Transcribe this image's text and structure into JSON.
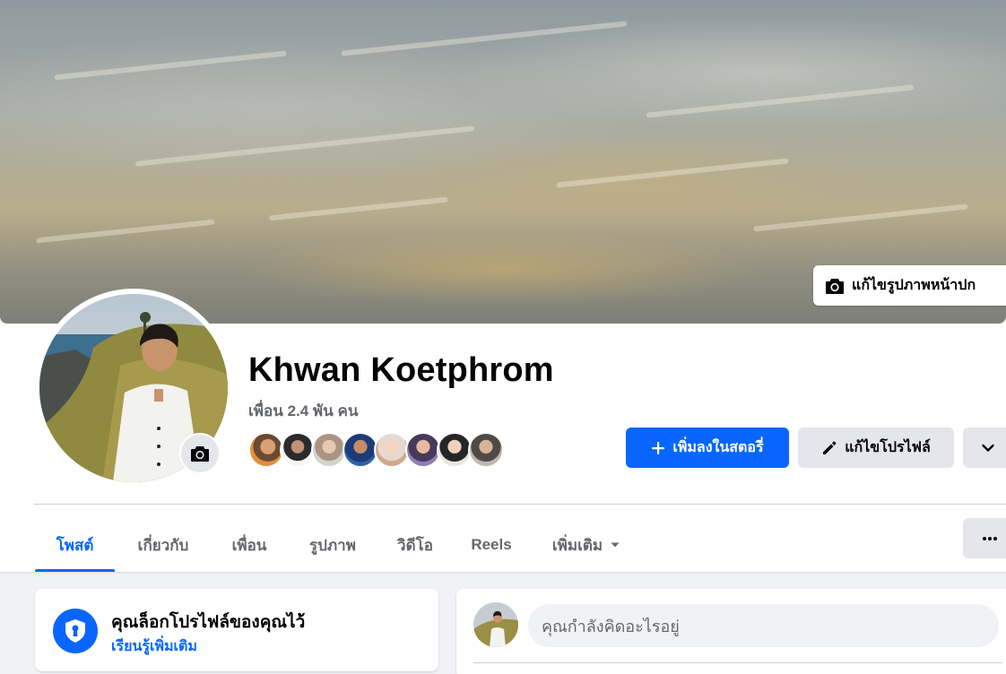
{
  "cover": {
    "edit_button_label": "แก้ไขรูปภาพหน้าปก",
    "edit_button_icon": "camera-icon"
  },
  "profile": {
    "name": "Khwan Koetphrom",
    "friend_count_text": "เพื่อน 2.4 พัน คน",
    "avatar_camera_icon": "camera-icon",
    "friend_avatar_count": 8
  },
  "actions": {
    "add_story_label": "เพิ่มลงในสตอรี่",
    "add_story_icon": "plus-icon",
    "edit_profile_label": "แก้ไขโปรไฟล์",
    "edit_profile_icon": "pencil-icon",
    "more_icon": "chevron-down-icon"
  },
  "tabs": {
    "items": [
      {
        "label": "โพสต์",
        "active": true
      },
      {
        "label": "เกี่ยวกับ",
        "active": false
      },
      {
        "label": "เพื่อน",
        "active": false
      },
      {
        "label": "รูปภาพ",
        "active": false
      },
      {
        "label": "วิดีโอ",
        "active": false
      },
      {
        "label": "Reels",
        "active": false
      },
      {
        "label": "เพิ่มเติม",
        "active": false
      }
    ],
    "more_dropdown_icon": "caret-down-icon",
    "overflow_icon": "ellipsis-icon"
  },
  "lock_notice": {
    "title": "คุณล็อกโปรไฟล์ของคุณไว้",
    "link": "เรียนรู้เพิ่มเติม",
    "icon": "shield-lock-icon"
  },
  "composer": {
    "placeholder": "คุณกำลังคิดอะไรอยู่"
  },
  "colors": {
    "accent": "#0866ff",
    "background": "#f0f2f5",
    "secondary_button": "#e4e6eb",
    "muted_text": "#65676b"
  }
}
